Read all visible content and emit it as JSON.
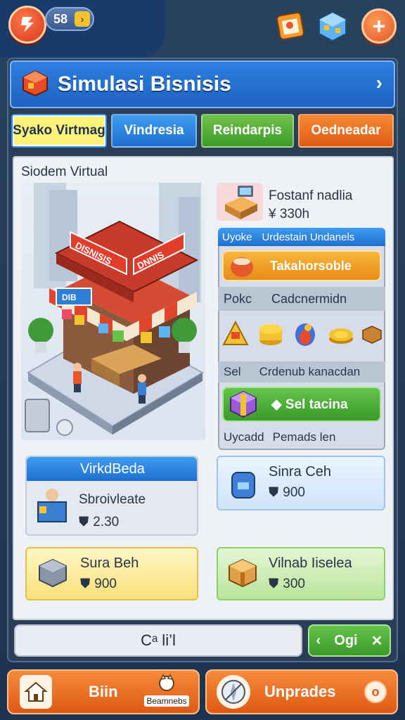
{
  "header": {
    "coin_amount": "58",
    "coin_arrow_icon": "chevron-right-icon",
    "avatar_icon": "logo-icon",
    "calendar_icon": "schedule-icon",
    "cube_icon": "cube-icon",
    "plus_icon": "plus-icon"
  },
  "panel": {
    "title": "Simulasi Bisnisis",
    "chevron": "›",
    "tabs": [
      {
        "label": "Syako Virtmag",
        "active": true
      },
      {
        "label": "Vindresia",
        "active": false
      },
      {
        "label": "Reindarpis",
        "active": false
      },
      {
        "label": "Oedneadar",
        "active": false
      }
    ],
    "section_label": "Siodem Virtual"
  },
  "scene": {
    "roof_sign_left": "DISNISIS",
    "roof_sign_right": "DNNIS",
    "shop_sign": "DIB"
  },
  "right": {
    "product": {
      "name": "Fostanf nadlia",
      "price": "¥ 330h"
    },
    "upgrade_header": {
      "left": "Uyoke",
      "right": "Urdestain Undanels"
    },
    "upgrade_button": "Takahorsoble",
    "row_label": {
      "left": "Pokc",
      "right": "Cadcnermidn"
    },
    "row2_label": {
      "left": "Sel",
      "right": "Crdenub kanacdan"
    },
    "sell_button": "◆ Sel tacina",
    "footer": {
      "left": "Uycadd",
      "right": "Pemads len"
    }
  },
  "cards": [
    {
      "title": "VirkdBeda",
      "name": "Sbroivleate",
      "price": "2.30",
      "type": "blue-header"
    },
    {
      "title": "Sinra Ceh",
      "price": "900",
      "type": "light-blue"
    },
    {
      "title": "Sura Beh",
      "price": "900",
      "type": "yellow"
    },
    {
      "title": "Vilnab Iiselea",
      "price": "300",
      "type": "green"
    }
  ],
  "bottom": {
    "field_text": "Cᵃ li’l",
    "green_left": "‹",
    "green_label": "Ogi",
    "green_right": "✕"
  },
  "nav": {
    "left_label": "Biin",
    "left_small": "Beamnebs",
    "right_label": "Unprades",
    "right_badge": "o"
  }
}
